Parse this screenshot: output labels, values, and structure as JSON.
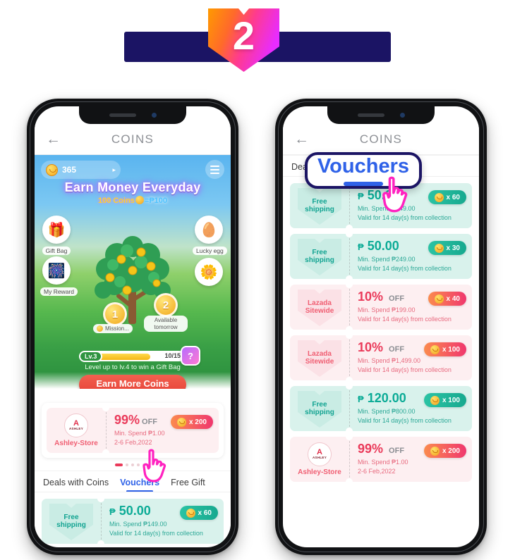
{
  "header": {
    "badge_number": "2",
    "bar_color": "#1b1464",
    "badge_gradient_from": "#ff8a1e",
    "badge_gradient_to": "#e82cff"
  },
  "phones": {
    "left": {
      "appbar": {
        "back_icon": "back-arrow-icon",
        "title": "COINS"
      },
      "game": {
        "coin_balance": "365",
        "coin_caret": "▸",
        "menu_icon": "hamburger-menu-icon",
        "title": "Earn Money Everyday",
        "subtitle_coins": "100 Coins",
        "subtitle_equals": "=₱100",
        "side_icons": [
          {
            "name": "gift-bag",
            "label": "Gift Bag",
            "glyph": "🎁"
          },
          {
            "name": "my-reward",
            "label": "My Reward",
            "glyph": "🎊"
          },
          {
            "name": "lucky-egg",
            "label": "Lucky egg",
            "glyph": "🥚"
          },
          {
            "name": "flower-bonus",
            "label": "",
            "glyph": "🌼"
          }
        ],
        "mission_1": {
          "num": "1",
          "label": "Mission..."
        },
        "mission_2": {
          "num": "2",
          "label": "Available tomorrow"
        }
      },
      "level": {
        "tag": "Lv.3",
        "progress": "10/15",
        "progress_pct": 66,
        "gift_icon": "mystery-gift-icon",
        "hint": "Level up to lv.4 to win a Gift Bag",
        "button": "Earn More Coins"
      },
      "promo": {
        "theme": "pink",
        "store_initial": "A",
        "store_name_logo": "ASHLEY",
        "store_label": "Ashley-Store",
        "amount": "99%",
        "unit": "OFF",
        "line1": "Min. Spend ₱1.00",
        "line2": "2-6 Feb,2022",
        "pill": "x 200"
      },
      "dots": {
        "total": 6,
        "active": 1
      },
      "tabs": [
        {
          "label": "Deals with Coins",
          "active": false
        },
        {
          "label": "Vouchers",
          "active": true
        },
        {
          "label": "Free Gift",
          "active": false
        }
      ],
      "bottom_voucher": {
        "theme": "mint",
        "left_line1": "Free",
        "left_line2": "shipping",
        "peso": "₱",
        "amount": "50.00",
        "line1": "Min. Spend ₱149.00",
        "line2": "Valid for 14 day(s) from collection",
        "pill": "x 60"
      }
    },
    "right": {
      "appbar": {
        "back_icon": "back-arrow-icon",
        "title": "COINS"
      },
      "tabs": [
        {
          "label": "Deals",
          "active": false
        },
        {
          "label": "Vouchers",
          "active": true
        }
      ],
      "callout": {
        "text": "Vouchers",
        "border_color": "#1b1464",
        "text_color": "#2f62e8"
      },
      "cursor_icon": "hand-pointer-cursor",
      "vouchers": [
        {
          "theme": "mint",
          "left_line1": "Free",
          "left_line2": "shipping",
          "peso": "₱",
          "amount": "50.00",
          "unit": "",
          "line1": "Min. Spend ₱149.00",
          "line2": "Valid for 14 day(s) from collection",
          "pill": "x 60"
        },
        {
          "theme": "mint",
          "left_line1": "Free",
          "left_line2": "shipping",
          "peso": "₱",
          "amount": "50.00",
          "unit": "",
          "line1": "Min. Spend ₱249.00",
          "line2": "Valid for 14 day(s) from collection",
          "pill": "x 30"
        },
        {
          "theme": "pink",
          "left_line1": "Lazada",
          "left_line2": "Sitewide",
          "peso": "",
          "amount": "10%",
          "unit": "OFF",
          "line1": "Min. Spend ₱199.00",
          "line2": "Valid for 14 day(s) from collection",
          "pill": "x 40"
        },
        {
          "theme": "pink",
          "left_line1": "Lazada",
          "left_line2": "Sitewide",
          "peso": "",
          "amount": "10%",
          "unit": "OFF",
          "line1": "Min. Spend ₱1,499.00",
          "line2": "Valid for 14 day(s) from collection",
          "pill": "x 100"
        },
        {
          "theme": "mint",
          "left_line1": "Free",
          "left_line2": "shipping",
          "peso": "₱",
          "amount": "120.00",
          "unit": "",
          "line1": "Min. Spend ₱800.00",
          "line2": "Valid for 14 day(s) from collection",
          "pill": "x 100"
        },
        {
          "theme": "pink",
          "left_line1": "",
          "left_line2": "Ashley-Store",
          "store_logo": true,
          "store_initial": "A",
          "store_name_logo": "ASHLEY",
          "peso": "",
          "amount": "99%",
          "unit": "OFF",
          "line1": "Min. Spend ₱1.00",
          "line2": "2-6 Feb,2022",
          "pill": "x 200"
        }
      ]
    }
  }
}
